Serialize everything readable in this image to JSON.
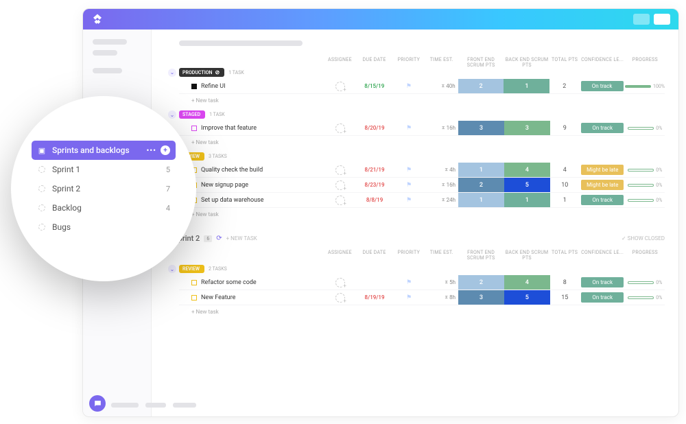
{
  "columns": {
    "assignee": "ASSIGNEE",
    "due": "DUE DATE",
    "priority": "PRIORITY",
    "time": "TIME EST.",
    "front": "FRONT END SCRUM PTS",
    "back": "BACK END SCRUM PTS",
    "total": "TOTAL PTS",
    "conf": "CONFIDENCE LE...",
    "prog": "PROGRESS"
  },
  "sections": [
    {
      "label": "PRODUCTION",
      "style": "prod",
      "meta": "1 TASK",
      "tasks": [
        {
          "square": "black",
          "name": "Refine UI",
          "due": "8/15/19",
          "due_style": "green",
          "time": "40h",
          "front": 2,
          "front_c": "sc-lightblue",
          "back": 1,
          "back_c": "sc-teal",
          "total": 2,
          "conf": "On track",
          "conf_c": "ontrack",
          "prog": 100
        }
      ]
    },
    {
      "label": "STAGED",
      "style": "staged",
      "meta": "1 TASK",
      "tasks": [
        {
          "square": "pink",
          "name": "Improve that feature",
          "due": "8/20/19",
          "due_style": "red",
          "time": "16h",
          "front": 3,
          "front_c": "sc-blue",
          "back": 3,
          "back_c": "sc-green",
          "total": 9,
          "conf": "On track",
          "conf_c": "ontrack",
          "prog": 0
        }
      ]
    },
    {
      "label": "REVIEW",
      "style": "review",
      "meta": "3 TASKS",
      "tasks": [
        {
          "square": "yellow",
          "name": "Quality check the build",
          "due": "8/21/19",
          "due_style": "red",
          "time": "4h",
          "front": 1,
          "front_c": "sc-lightblue",
          "back": 4,
          "back_c": "sc-green",
          "total": 4,
          "conf": "Might be late",
          "conf_c": "late",
          "prog": 0
        },
        {
          "square": "yellow",
          "name": "New signup page",
          "due": "8/23/19",
          "due_style": "red",
          "time": "16h",
          "front": 2,
          "front_c": "sc-blue",
          "back": 5,
          "back_c": "sc-darkblue",
          "total": 10,
          "conf": "Might be late",
          "conf_c": "late",
          "prog": 0
        },
        {
          "square": "yellow",
          "name": "Set up data warehouse",
          "due": "8/8/19",
          "due_style": "red",
          "time": "24h",
          "front": 1,
          "front_c": "sc-lightblue",
          "back": 1,
          "back_c": "sc-teal",
          "total": 1,
          "conf": "On track",
          "conf_c": "ontrack",
          "prog": 0
        }
      ]
    }
  ],
  "sprint2": {
    "title": "Sprint 2",
    "badge": "6",
    "new_task": "+ NEW TASK",
    "show_closed": "✓ SHOW CLOSED",
    "section": {
      "label": "REVIEW",
      "style": "review",
      "meta": "2 TASKS",
      "tasks": [
        {
          "square": "yellow",
          "name": "Refactor some code",
          "due": "",
          "due_style": "",
          "time": "5h",
          "front": 2,
          "front_c": "sc-lightblue",
          "back": 4,
          "back_c": "sc-green",
          "total": 8,
          "conf": "On track",
          "conf_c": "ontrack",
          "prog": 0
        },
        {
          "square": "yellow",
          "name": "New Feature",
          "due": "8/19/19",
          "due_style": "red",
          "time": "8h",
          "front": 3,
          "front_c": "sc-blue",
          "back": 5,
          "back_c": "sc-darkblue",
          "total": 15,
          "conf": "On track",
          "conf_c": "ontrack",
          "prog": 0
        }
      ]
    }
  },
  "new_task_label": "+ New task",
  "popout": {
    "header": "Sprints and backlogs",
    "items": [
      {
        "label": "Sprint 1",
        "count": 5
      },
      {
        "label": "Sprint 2",
        "count": 7
      },
      {
        "label": "Backlog",
        "count": 4
      },
      {
        "label": "Bugs",
        "count": ""
      }
    ]
  }
}
